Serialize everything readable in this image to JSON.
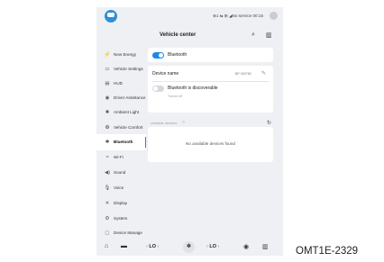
{
  "status": {
    "text": "⊕1 ⇆ ⊞ ◢No service 00:15"
  },
  "header": {
    "title": "Vehicle center",
    "search_icon": "search-icon",
    "menu_icon": "manual-icon"
  },
  "sidebar": {
    "items": [
      {
        "label": "New Energy",
        "icon": "⚡"
      },
      {
        "label": "Vehicle Settings",
        "icon": "▭"
      },
      {
        "label": "HUD",
        "icon": "▤"
      },
      {
        "label": "Driver Assistance",
        "icon": "◉"
      },
      {
        "label": "Ambient Light",
        "icon": "✺"
      },
      {
        "label": "Vehicle Comfort",
        "icon": "❂"
      },
      {
        "label": "Bluetooth",
        "icon": "✱"
      },
      {
        "label": "Wi-Fi",
        "icon": "≈"
      },
      {
        "label": "Sound",
        "icon": "◀)"
      },
      {
        "label": "Voice",
        "icon": "🎙"
      },
      {
        "label": "Display",
        "icon": "☀"
      },
      {
        "label": "System",
        "icon": "⚙"
      },
      {
        "label": "Device Manage",
        "icon": "▢"
      }
    ],
    "active_index": 6
  },
  "bluetooth": {
    "toggle_label": "Bluetooth",
    "toggle_on": true,
    "device_name_label": "Device name",
    "device_name_value": "BP 000782",
    "discoverable_label": "Bluetooth is discoverable",
    "discoverable_sub": "Turned off",
    "discoverable_on": false,
    "usable_devices_label": "Useable devices",
    "no_devices_text": "No available devices found"
  },
  "bottom": {
    "left_temp": "LO",
    "right_temp": "LO"
  },
  "figure_code": "OMT1E-2329",
  "colors": {
    "accent": "#1e88e5",
    "background": "#eef0f3"
  }
}
